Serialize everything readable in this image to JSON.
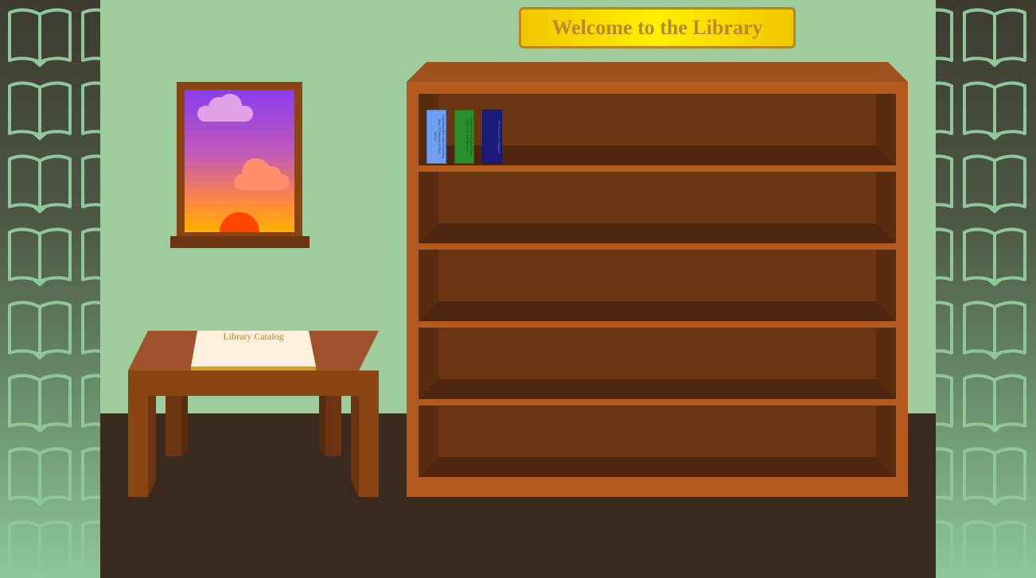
{
  "sign": {
    "title": "Welcome to the Library"
  },
  "books": [
    {
      "title": "Something Borrowed: Something Blue: A Collection of Short Stories",
      "color": "#6f9ef0",
      "text_color": "#1a3b80"
    },
    {
      "title": "Another Green Book of Tales: The Forest and The River",
      "color": "#2a8f2a",
      "text_color": "#0e4a0e"
    },
    {
      "title": "The Bookseller's Daughter",
      "color": "#1b1b7a",
      "text_color": "#6b6bd0"
    }
  ],
  "table": {
    "catalog_label": "Library Catalog"
  },
  "colors": {
    "wall": "#9fcc9c",
    "floor": "#3a2a1e",
    "wood": "#8b4513",
    "sign_border": "#b8861c",
    "sign_text": "#b88a2c"
  },
  "icons": {
    "side_pattern": "open-book-icon"
  }
}
